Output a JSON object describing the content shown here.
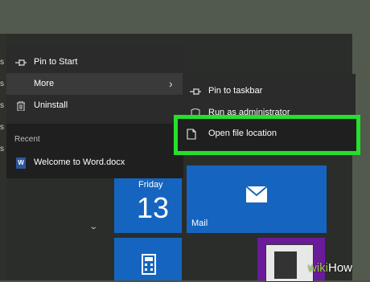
{
  "context_menu": {
    "items": [
      {
        "label": "Pin to Start",
        "icon": "pin-icon"
      },
      {
        "label": "More",
        "icon": "",
        "has_submenu": true
      },
      {
        "label": "Uninstall",
        "icon": "trash-icon"
      }
    ],
    "recent_header": "Recent",
    "recent_items": [
      {
        "label": "Welcome to Word.docx",
        "icon": "word-doc-icon"
      }
    ]
  },
  "submenu": {
    "items": [
      {
        "label": "Pin to taskbar",
        "icon": "pin-icon"
      },
      {
        "label": "Run as administrator",
        "icon": "shield-icon"
      },
      {
        "label": "Open file location",
        "icon": "file-icon",
        "highlighted": true
      }
    ]
  },
  "tiles": {
    "calendar": {
      "day_name": "Friday",
      "day_number": "13"
    },
    "mail": {
      "label": "Mail"
    }
  },
  "left_strip": [
    "s",
    "s",
    "s",
    "s",
    "s"
  ],
  "watermark": {
    "prefix": "wiki",
    "suffix": "How"
  },
  "colors": {
    "highlight": "#25e02b",
    "tile_blue": "#1565c0",
    "menu_bg": "#2b2b2b"
  }
}
